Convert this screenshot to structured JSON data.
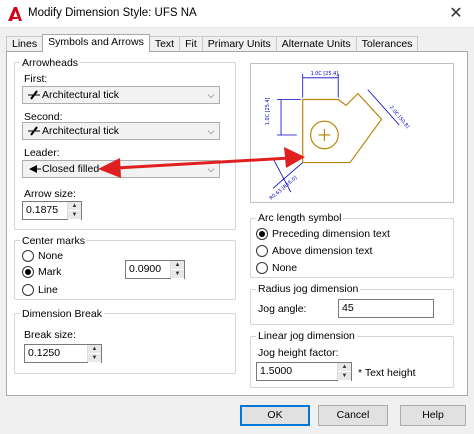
{
  "window": {
    "title": "Modify Dimension Style: UFS NA",
    "close_glyph": "✕"
  },
  "tabs": [
    {
      "label": "Lines",
      "active": false
    },
    {
      "label": "Symbols and Arrows",
      "active": true
    },
    {
      "label": "Text",
      "active": false
    },
    {
      "label": "Fit",
      "active": false
    },
    {
      "label": "Primary Units",
      "active": false
    },
    {
      "label": "Alternate Units",
      "active": false
    },
    {
      "label": "Tolerances",
      "active": false
    }
  ],
  "arrowheads": {
    "group_label": "Arrowheads",
    "first_label": "First:",
    "first_value": "Architectural tick",
    "second_label": "Second:",
    "second_value": "Architectural tick",
    "leader_label": "Leader:",
    "leader_value": "Closed filled",
    "arrow_size_label": "Arrow size:",
    "arrow_size_value": "0.1875"
  },
  "center_marks": {
    "group_label": "Center marks",
    "options": [
      "None",
      "Mark",
      "Line"
    ],
    "selected": "Mark",
    "size_value": "0.0900"
  },
  "dimension_break": {
    "group_label": "Dimension Break",
    "break_size_label": "Break size:",
    "break_size_value": "0.1250"
  },
  "arc_length_symbol": {
    "group_label": "Arc length symbol",
    "options": [
      "Preceding dimension text",
      "Above dimension text",
      "None"
    ],
    "selected": "Preceding dimension text"
  },
  "radius_jog": {
    "group_label": "Radius jog dimension",
    "jog_angle_label": "Jog angle:",
    "jog_angle_value": "45"
  },
  "linear_jog": {
    "group_label": "Linear jog dimension",
    "jog_height_label": "Jog height factor:",
    "jog_height_value": "1.5000",
    "suffix": "* Text height"
  },
  "buttons": {
    "ok": "OK",
    "cancel": "Cancel",
    "help": "Help"
  },
  "icons": {
    "app": "autocad-logo-icon",
    "tick": "architectural-tick-icon",
    "leader": "closed-filled-arrow-icon",
    "dropdown": "chevron-down-icon",
    "spin_up": "spin-up-icon",
    "spin_down": "spin-down-icon"
  },
  "colors": {
    "annotation_arrow": "#e02020",
    "preview_shape": "#b8860b",
    "preview_dims": "#0000cc",
    "logo": "#d0021b"
  }
}
